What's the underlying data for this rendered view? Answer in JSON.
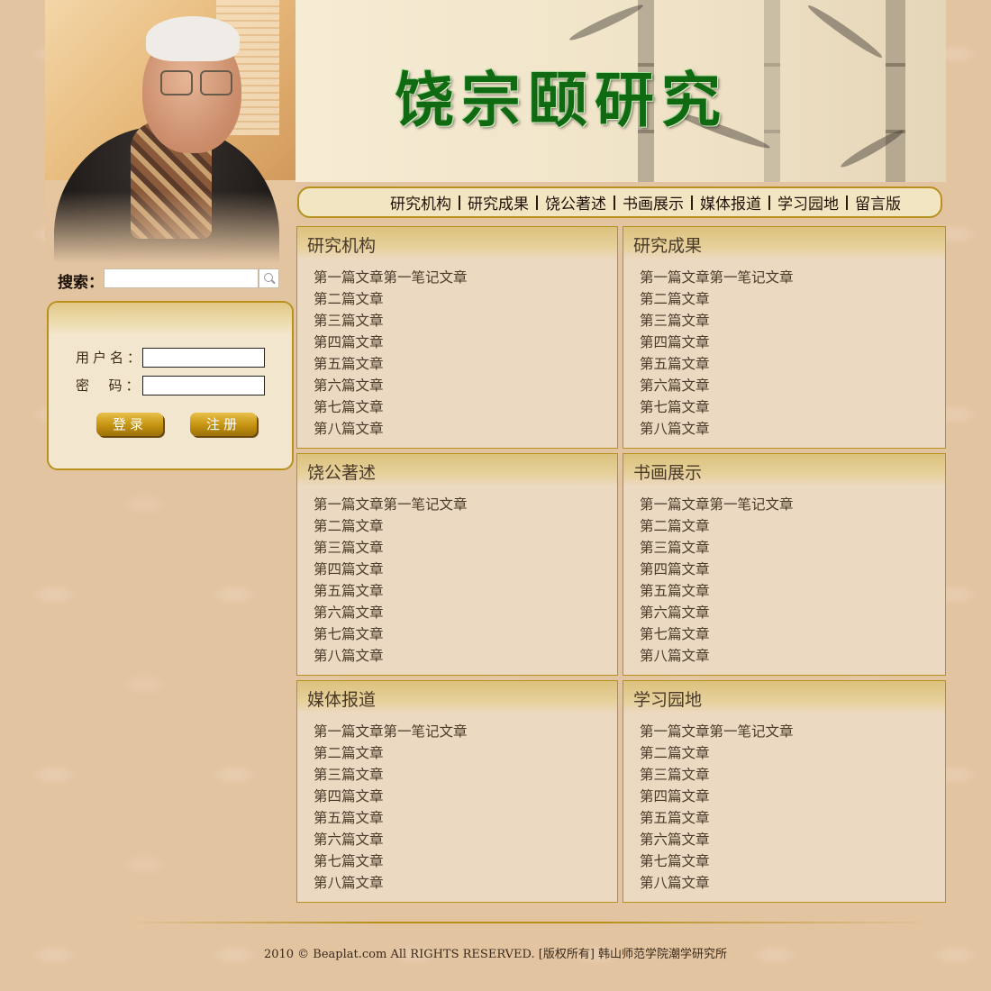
{
  "banner": {
    "title": "饶宗颐研究"
  },
  "nav": {
    "items": [
      {
        "label": "研究机构"
      },
      {
        "label": "研究成果"
      },
      {
        "label": "饶公著述"
      },
      {
        "label": "书画展示"
      },
      {
        "label": "媒体报道"
      },
      {
        "label": "学习园地"
      },
      {
        "label": "留言版"
      }
    ]
  },
  "search": {
    "label": "搜索：",
    "value": ""
  },
  "login": {
    "username_label": "用户名：",
    "password_label": "密  码：",
    "login_button": "登录",
    "register_button": "注册"
  },
  "panels": [
    {
      "title": "研究机构",
      "items": [
        "第一篇文章第一笔记文章",
        "第二篇文章",
        "第三篇文章",
        "第四篇文章",
        "第五篇文章",
        "第六篇文章",
        "第七篇文章",
        "第八篇文章"
      ]
    },
    {
      "title": "研究成果",
      "items": [
        "第一篇文章第一笔记文章",
        "第二篇文章",
        "第三篇文章",
        "第四篇文章",
        "第五篇文章",
        "第六篇文章",
        "第七篇文章",
        "第八篇文章"
      ]
    },
    {
      "title": "饶公著述",
      "items": [
        "第一篇文章第一笔记文章",
        "第二篇文章",
        "第三篇文章",
        "第四篇文章",
        "第五篇文章",
        "第六篇文章",
        "第七篇文章",
        "第八篇文章"
      ]
    },
    {
      "title": "书画展示",
      "items": [
        "第一篇文章第一笔记文章",
        "第二篇文章",
        "第三篇文章",
        "第四篇文章",
        "第五篇文章",
        "第六篇文章",
        "第七篇文章",
        "第八篇文章"
      ]
    },
    {
      "title": "媒体报道",
      "items": [
        "第一篇文章第一笔记文章",
        "第二篇文章",
        "第三篇文章",
        "第四篇文章",
        "第五篇文章",
        "第六篇文章",
        "第七篇文章",
        "第八篇文章"
      ]
    },
    {
      "title": "学习园地",
      "items": [
        "第一篇文章第一笔记文章",
        "第二篇文章",
        "第三篇文章",
        "第四篇文章",
        "第五篇文章",
        "第六篇文章",
        "第七篇文章",
        "第八篇文章"
      ]
    }
  ],
  "footer": {
    "text": "2010 © Beaplat.com All RIGHTS RESERVED. [版权所有] 韩山师范学院潮学研究所"
  },
  "colors": {
    "page_bg": "#e3c4a1",
    "accent": "#b8901e",
    "title_green": "#0f6a12",
    "panel_bg": "#ecd9c1"
  }
}
